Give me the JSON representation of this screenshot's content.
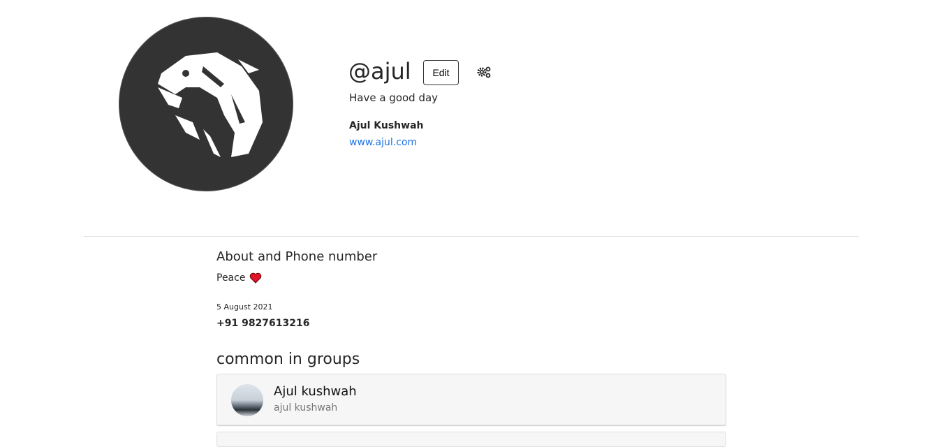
{
  "profile": {
    "handle": "@ajul",
    "edit_label": "Edit",
    "settings_icon": "gears-icon",
    "bio": "Have a good day",
    "full_name": "Ajul Kushwah",
    "website": "www.ajul.com"
  },
  "about": {
    "title": "About and Phone number",
    "text": "Peace",
    "emoji": "heart-icon",
    "date": "5 August 2021",
    "phone": "+91 9827613216"
  },
  "groups": {
    "title": "common in groups",
    "items": [
      {
        "name": "Ajul kushwah",
        "subtitle": "ajul kushwah"
      }
    ]
  }
}
